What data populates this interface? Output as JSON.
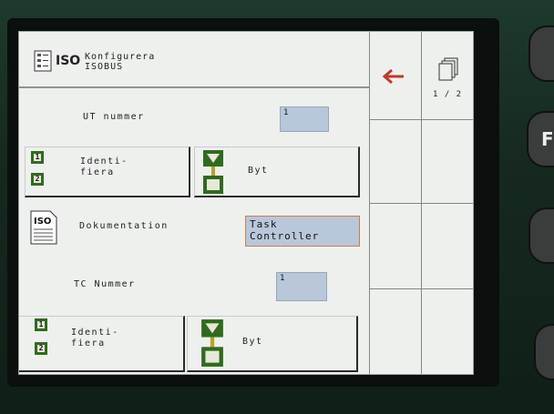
{
  "header": {
    "iso_label": "ISO",
    "title": "Konfigurera\nISOBUS"
  },
  "ut": {
    "label": "UT nummer",
    "value": "1"
  },
  "identify_button_1": {
    "label": "Identi-\nfiera",
    "numbers": [
      "1",
      "2"
    ]
  },
  "swap_button_1": {
    "label": "Byt"
  },
  "documentation": {
    "icon_label": "ISO",
    "label": "Dokumentation",
    "value": "Task\nController"
  },
  "tc": {
    "label": "TC Nummer",
    "value": "1"
  },
  "identify_button_2": {
    "label": "Identi-\nfiera",
    "numbers": [
      "1",
      "2"
    ]
  },
  "swap_button_2": {
    "label": "Byt"
  },
  "softkeys": {
    "page_indicator": "1 / 2"
  },
  "colors": {
    "screen_bg": "#eef0ee",
    "field_bg": "#b9c7da",
    "icon_green": "#2f6b1e",
    "back_arrow_red": "#c0392b"
  }
}
